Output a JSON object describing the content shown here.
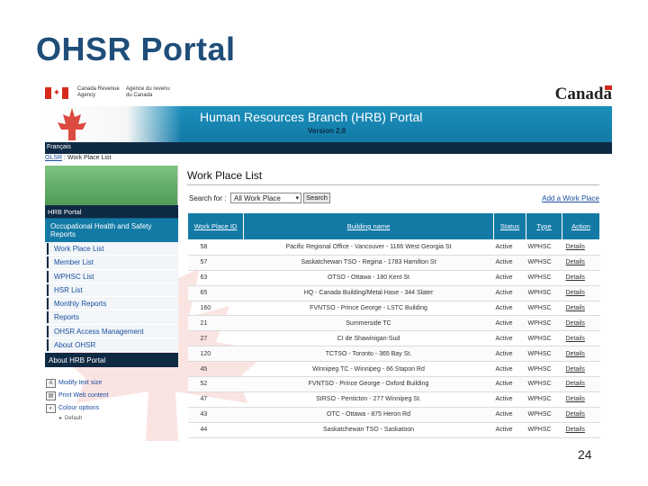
{
  "slide": {
    "title": "OHSR Portal",
    "number": "24"
  },
  "gov_header": {
    "agency_en": "Canada Revenue\nAgency",
    "agency_fr": "Agence du revenu\ndu Canada",
    "wordmark": "Canada"
  },
  "banner": {
    "title": "Human Resources Branch (HRB) Portal",
    "version": "Version 2.0"
  },
  "top_bar": {
    "language": "Français"
  },
  "breadcrumb": {
    "root": "OLSR",
    "separator": " : ",
    "current": "Work Place List"
  },
  "sidebar": {
    "header": "HRB Portal",
    "section": "Occupational Health and Safety Reports",
    "items": [
      {
        "label": "Work Place List"
      },
      {
        "label": "Member List"
      },
      {
        "label": "WPHSC List"
      },
      {
        "label": "HSR List"
      },
      {
        "label": "Monthly Reports"
      },
      {
        "label": "Reports"
      },
      {
        "label": "OHSR Access Management"
      },
      {
        "label": "About OHSR"
      }
    ],
    "footer": "About HRB Portal"
  },
  "tools": {
    "items": [
      {
        "label": "Modify text size",
        "icon": "A"
      },
      {
        "label": "Print Web content",
        "icon": "▤"
      },
      {
        "label": "Colour options",
        "icon": "◐"
      }
    ],
    "sub": "Default"
  },
  "main": {
    "title": "Work Place List",
    "search_label": "Search for :",
    "search_value": "All Work Place",
    "search_button": "Search",
    "add_link": "Add a Work Place",
    "columns": {
      "id": "Work Place ID",
      "name": "Building name",
      "status": "Status",
      "type": "Type",
      "action": "Action"
    },
    "rows": [
      {
        "id": "58",
        "name": "Pacific Regional Office - Vancouver - 1166 West Georgia St",
        "status": "Active",
        "type": "WPHSC",
        "action": "Details"
      },
      {
        "id": "57",
        "name": "Saskatchewan TSO - Regina - 1783 Hamilton St",
        "status": "Active",
        "type": "WPHSC",
        "action": "Details"
      },
      {
        "id": "63",
        "name": "OTSO - Ottawa - 180 Kent St",
        "status": "Active",
        "type": "WPHSC",
        "action": "Details"
      },
      {
        "id": "65",
        "name": "HQ - Canada Building/Metal Hase - 344 Slater",
        "status": "Active",
        "type": "WPHSC",
        "action": "Details"
      },
      {
        "id": "160",
        "name": "FVNTSO - Prince George - LSTC Building",
        "status": "Active",
        "type": "WPHSC",
        "action": "Details"
      },
      {
        "id": "21",
        "name": "Summerside TC",
        "status": "Active",
        "type": "WPHSC",
        "action": "Details"
      },
      {
        "id": "27",
        "name": "CI de Shawinigan-Sud",
        "status": "Active",
        "type": "WPHSC",
        "action": "Details"
      },
      {
        "id": "120",
        "name": "TCTSO - Toronto - 365 Bay St.",
        "status": "Active",
        "type": "WPHSC",
        "action": "Details"
      },
      {
        "id": "45",
        "name": "Winnipeg TC - Winnipeg - 66 Stapon Rd",
        "status": "Active",
        "type": "WPHSC",
        "action": "Details"
      },
      {
        "id": "52",
        "name": "FVNTSO - Prince George - Oxford Building",
        "status": "Active",
        "type": "WPHSC",
        "action": "Details"
      },
      {
        "id": "47",
        "name": "SIRSO - Penticton - 277 Winnipeg St.",
        "status": "Active",
        "type": "WPHSC",
        "action": "Details"
      },
      {
        "id": "43",
        "name": "OTC - Ottawa - 875 Heron Rd",
        "status": "Active",
        "type": "WPHSC",
        "action": "Details"
      },
      {
        "id": "44",
        "name": "Saskatchewan TSO - Saskatoon",
        "status": "Active",
        "type": "WPHSC",
        "action": "Details"
      }
    ]
  },
  "colors": {
    "title_blue": "#1f4e79",
    "banner_teal": "#137aa6",
    "navy": "#0f2a44",
    "green": "#4e9a55",
    "link_blue": "#1a4fa0",
    "flag_red": "#d52b1e"
  }
}
